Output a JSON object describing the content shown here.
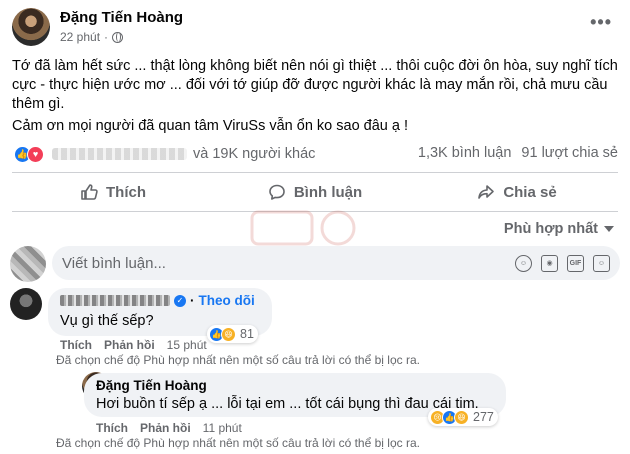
{
  "post": {
    "author": "Đặng Tiến Hoàng",
    "time": "22 phút",
    "more": "•••",
    "text1": "Tớ đã làm hết sức ... thật lòng không biết nên nói gì thiệt ... thôi cuộc đời ôn hòa, suy nghĩ tích cực - thực hiện ước mơ ... đối với tớ giúp đỡ được người khác là may mắn rồi, chả mưu cầu thêm gì.",
    "text2": "Cảm ơn mọi người đã quan tâm ViruSs vẫn ổn ko sao đâu ạ !",
    "reactions_suffix": "và 19K người khác",
    "comments_count": "1,3K bình luận",
    "shares_count": "91 lượt chia sẻ"
  },
  "actions": {
    "like": "Thích",
    "comment": "Bình luận",
    "share": "Chia sẻ"
  },
  "sort": {
    "label": "Phù hợp nhất"
  },
  "composer": {
    "placeholder": "Viết bình luận..."
  },
  "comments": [
    {
      "follow": "Theo dõi",
      "text": "Vụ gì thế sếp?",
      "reactions": "81",
      "like": "Thích",
      "reply": "Phản hồi",
      "time": "15 phút",
      "note": "Đã chọn chế độ Phù hợp nhất nên một số câu trả lời có thể bị lọc ra."
    }
  ],
  "reply": {
    "author": "Đặng Tiến Hoàng",
    "text": "Hơi buồn tí sếp ạ ... lỗi tại em ... tốt cái bụng thì đau cái tim.",
    "reactions": "277",
    "like": "Thích",
    "reply": "Phản hồi",
    "time": "11 phút",
    "note": "Đã chọn chế độ Phù hợp nhất nên một số câu trả lời có thể bị lọc ra."
  },
  "colors": {
    "accent": "#1877f2",
    "secondary_text": "#65676b",
    "bubble": "#f0f2f5",
    "love": "#f33e58",
    "haha": "#f7b125"
  }
}
